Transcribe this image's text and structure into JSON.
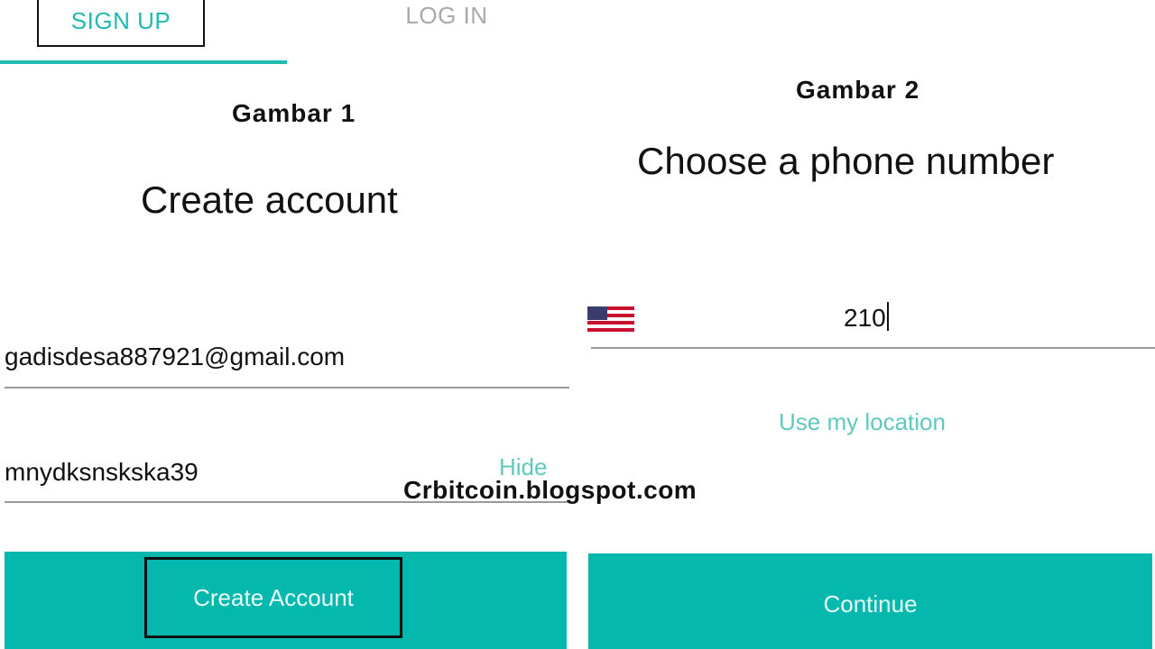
{
  "panel1": {
    "tabs": {
      "signup": "SIGN UP",
      "login": "LOG IN"
    },
    "caption": "Gambar 1",
    "title": "Create account",
    "email_value": "gadisdesa887921@gmail.com",
    "password_value": "mnydksnskska39",
    "hide_label": "Hide",
    "create_button": "Create Account"
  },
  "panel2": {
    "caption": "Gambar 2",
    "title": "Choose a phone number",
    "phone_value": "210",
    "location_link": "Use my location",
    "continue_button": "Continue",
    "flag_icon": "us-flag-icon"
  },
  "watermark": "Crbitcoin.blogspot.com",
  "colors": {
    "accent": "#1fbab0",
    "button": "#05b8ad",
    "link": "#5fc9c0"
  }
}
